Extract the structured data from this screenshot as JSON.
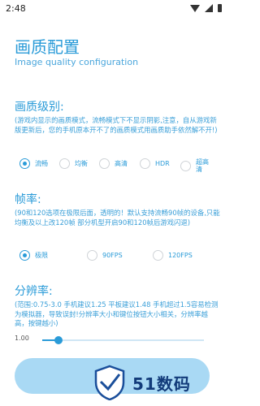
{
  "status_bar": {
    "time": "2:48"
  },
  "header": {
    "title": "画质配置",
    "subtitle": "Image quality configuration"
  },
  "quality": {
    "title": "画质级别:",
    "note": "(游戏内显示的画质模式，流畅模式下不显示阴影,注意，自从游戏新版更新后，您的手机原本开不了的画质模式用画质助手依然解不开!)",
    "options": [
      "流畅",
      "均衡",
      "高清",
      "HDR",
      "超高清"
    ],
    "selected": "流畅"
  },
  "fps": {
    "title": "帧率:",
    "note": "(90和120选项在极限后面，透明的！默认支持流畅90帧的设备,只能均衡及以上改120帧  部分机型开启90和120帧后游戏闪退)",
    "options": [
      "极限",
      "90FPS",
      "120FPS"
    ],
    "selected": "极限"
  },
  "resolution": {
    "title": "分辨率:",
    "note": "(范围:0.75-3.0  手机建议1.25 平板建议1.48  手机超过1.5容易检测为模拟器，导致误封!分辨率大小和键位按钮大小相关，分辨率越高，按键越小)",
    "value": "1.00",
    "fill_fraction": 0.1
  },
  "watermark": {
    "text": "51数码"
  },
  "colors": {
    "accent": "#2a9bd8",
    "button": "#a9d9f4",
    "logo": "#123b7a"
  }
}
